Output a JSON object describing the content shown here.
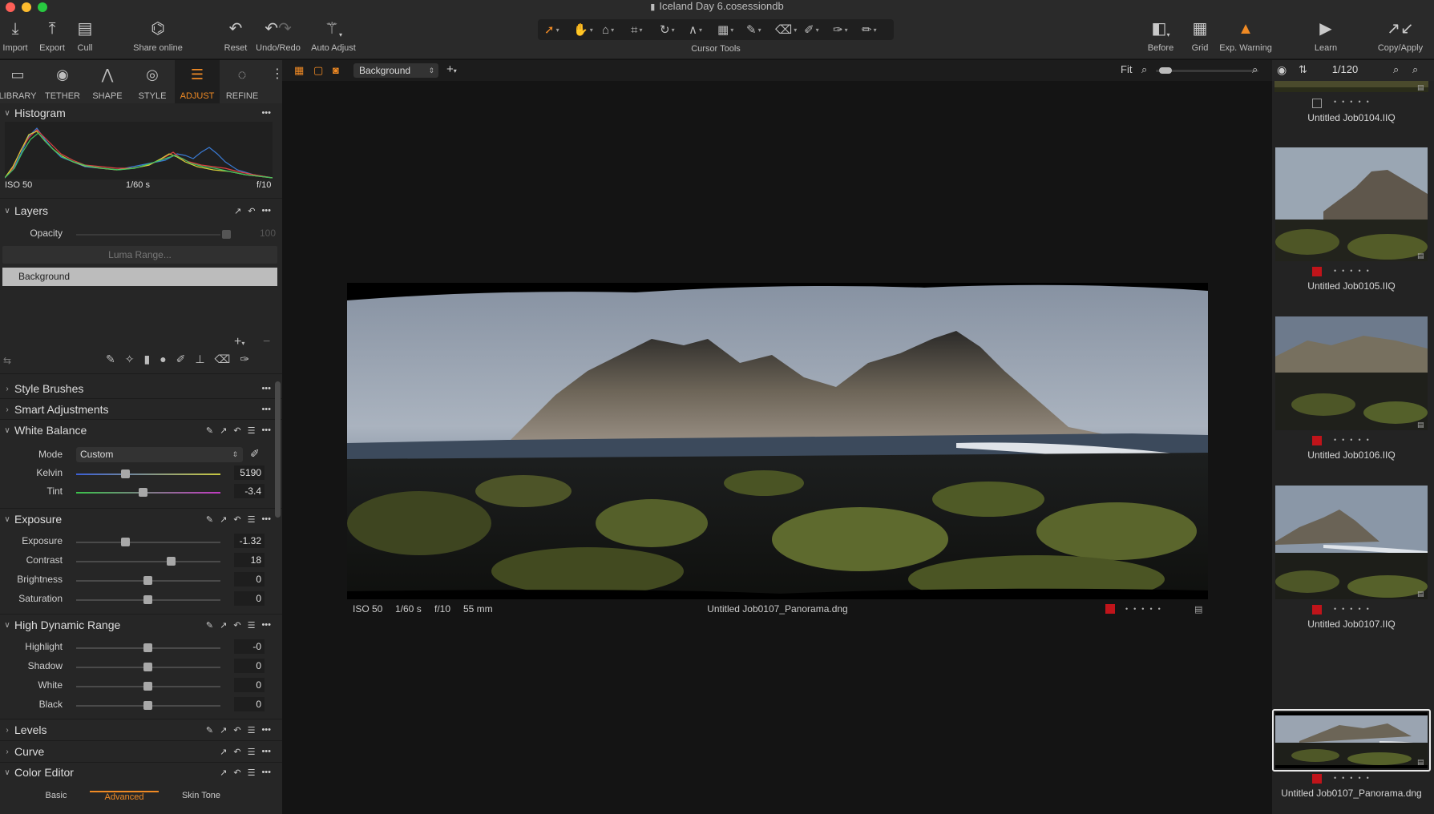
{
  "window": {
    "title": "Iceland Day 6.cosessiondb"
  },
  "toolbar": {
    "import": "Import",
    "export": "Export",
    "cull": "Cull",
    "share": "Share online",
    "reset": "Reset",
    "undo_redo": "Undo/Redo",
    "auto_adjust": "Auto Adjust",
    "cursor_tools": "Cursor Tools",
    "before": "Before",
    "grid": "Grid",
    "exp_warning": "Exp. Warning",
    "learn": "Learn",
    "copy_apply": "Copy/Apply"
  },
  "tool_tabs": [
    "LIBRARY",
    "TETHER",
    "SHAPE",
    "STYLE",
    "ADJUST",
    "REFINE"
  ],
  "histogram": {
    "title": "Histogram",
    "iso": "ISO 50",
    "shutter": "1/60 s",
    "aperture": "f/10"
  },
  "layers": {
    "title": "Layers",
    "opacity_label": "Opacity",
    "opacity_value": "100",
    "luma_range": "Luma Range...",
    "selected_layer": "Background"
  },
  "sections": {
    "style_brushes": "Style Brushes",
    "smart_adjustments": "Smart Adjustments",
    "white_balance": "White Balance",
    "exposure": "Exposure",
    "hdr": "High Dynamic Range",
    "levels": "Levels",
    "curve": "Curve",
    "color_editor": "Color Editor"
  },
  "white_balance": {
    "mode_label": "Mode",
    "mode_value": "Custom",
    "kelvin_label": "Kelvin",
    "kelvin_value": "5190",
    "tint_label": "Tint",
    "tint_value": "-3.4"
  },
  "exposure": {
    "exposure_label": "Exposure",
    "exposure_value": "-1.32",
    "contrast_label": "Contrast",
    "contrast_value": "18",
    "brightness_label": "Brightness",
    "brightness_value": "0",
    "saturation_label": "Saturation",
    "saturation_value": "0"
  },
  "hdr": {
    "highlight_label": "Highlight",
    "highlight_value": "-0",
    "shadow_label": "Shadow",
    "shadow_value": "0",
    "white_label": "White",
    "white_value": "0",
    "black_label": "Black",
    "black_value": "0"
  },
  "color_editor_tabs": {
    "basic": "Basic",
    "advanced": "Advanced",
    "skin_tone": "Skin Tone"
  },
  "viewer": {
    "layer_select": "Background",
    "zoom": "Fit",
    "iso": "ISO 50",
    "shutter": "1/60 s",
    "aperture": "f/10",
    "focal": "55 mm",
    "filename": "Untitled Job0107_Panorama.dng"
  },
  "browser": {
    "counter": "1/120",
    "thumbs": [
      "Untitled Job0104.IIQ",
      "Untitled Job0105.IIQ",
      "Untitled Job0106.IIQ",
      "Untitled Job0107.IIQ",
      "Untitled Job0107_Panorama.dng"
    ]
  },
  "colors": {
    "accent": "#f08a24",
    "rating_red": "#c0141a"
  }
}
